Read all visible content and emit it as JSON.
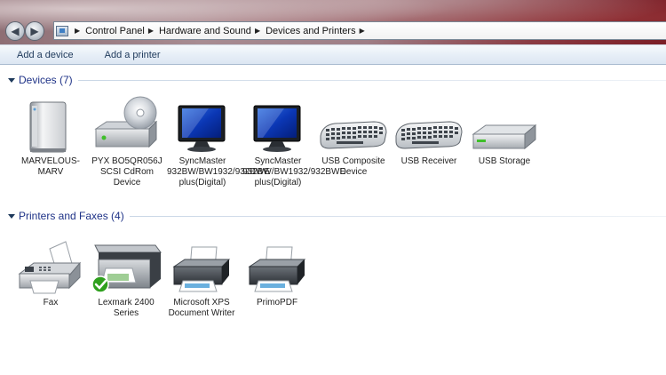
{
  "breadcrumb": {
    "items": [
      "Control Panel",
      "Hardware and Sound",
      "Devices and Printers"
    ]
  },
  "commandbar": {
    "add_device": "Add a device",
    "add_printer": "Add a printer"
  },
  "devices": {
    "title": "Devices (7)",
    "items": [
      {
        "label": "MARVELOUS-MARV",
        "icon": "computer-tower-icon"
      },
      {
        "label": "PYX BO5QR056J SCSI CdRom Device",
        "icon": "cd-drive-icon"
      },
      {
        "label": "SyncMaster 932BW/BW1932/932BWE plus(Digital)",
        "icon": "monitor-icon"
      },
      {
        "label": "SyncMaster 932BW/BW1932/932BWE plus(Digital)",
        "icon": "monitor-icon"
      },
      {
        "label": "USB Composite Device",
        "icon": "keyboard-icon"
      },
      {
        "label": "USB Receiver",
        "icon": "keyboard-icon"
      },
      {
        "label": "USB Storage",
        "icon": "external-drive-icon"
      }
    ]
  },
  "printers": {
    "title": "Printers and Faxes (4)",
    "items": [
      {
        "label": "Fax",
        "icon": "fax-icon"
      },
      {
        "label": "Lexmark 2400 Series",
        "icon": "multifunction-printer-icon",
        "default": true
      },
      {
        "label": "Microsoft XPS Document Writer",
        "icon": "printer-icon"
      },
      {
        "label": "PrimoPDF",
        "icon": "printer-icon"
      }
    ]
  },
  "colors": {
    "group_title": "#1e3287",
    "command_text": "#1e395b",
    "default_check": "#2fa01e"
  }
}
